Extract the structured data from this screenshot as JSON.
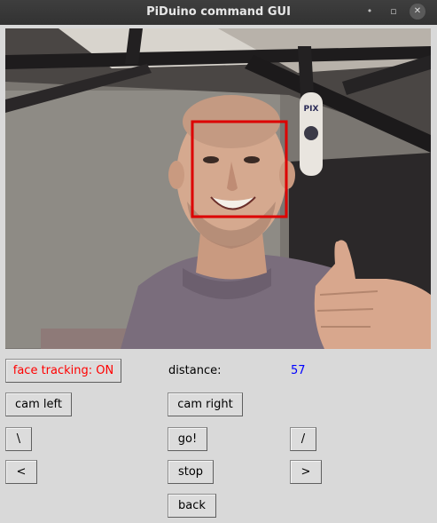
{
  "window": {
    "title": "PiDuino command GUI",
    "minimize_symbol": "•",
    "maximize_symbol": "▫",
    "close_symbol": "✕"
  },
  "camera": {
    "sign_text": "PIX",
    "face_box_color": "#dd0000"
  },
  "controls": {
    "face_tracking_label": "face tracking: ON",
    "face_tracking_color": "#ff0000",
    "distance_label": "distance:",
    "distance_value": "57",
    "distance_value_color": "#0000ff",
    "cam_left_label": "cam left",
    "cam_right_label": "cam right",
    "forward_left_label": "\\",
    "go_label": "go!",
    "forward_right_label": "/",
    "turn_left_label": "<",
    "stop_label": "stop",
    "turn_right_label": ">",
    "back_label": "back"
  }
}
